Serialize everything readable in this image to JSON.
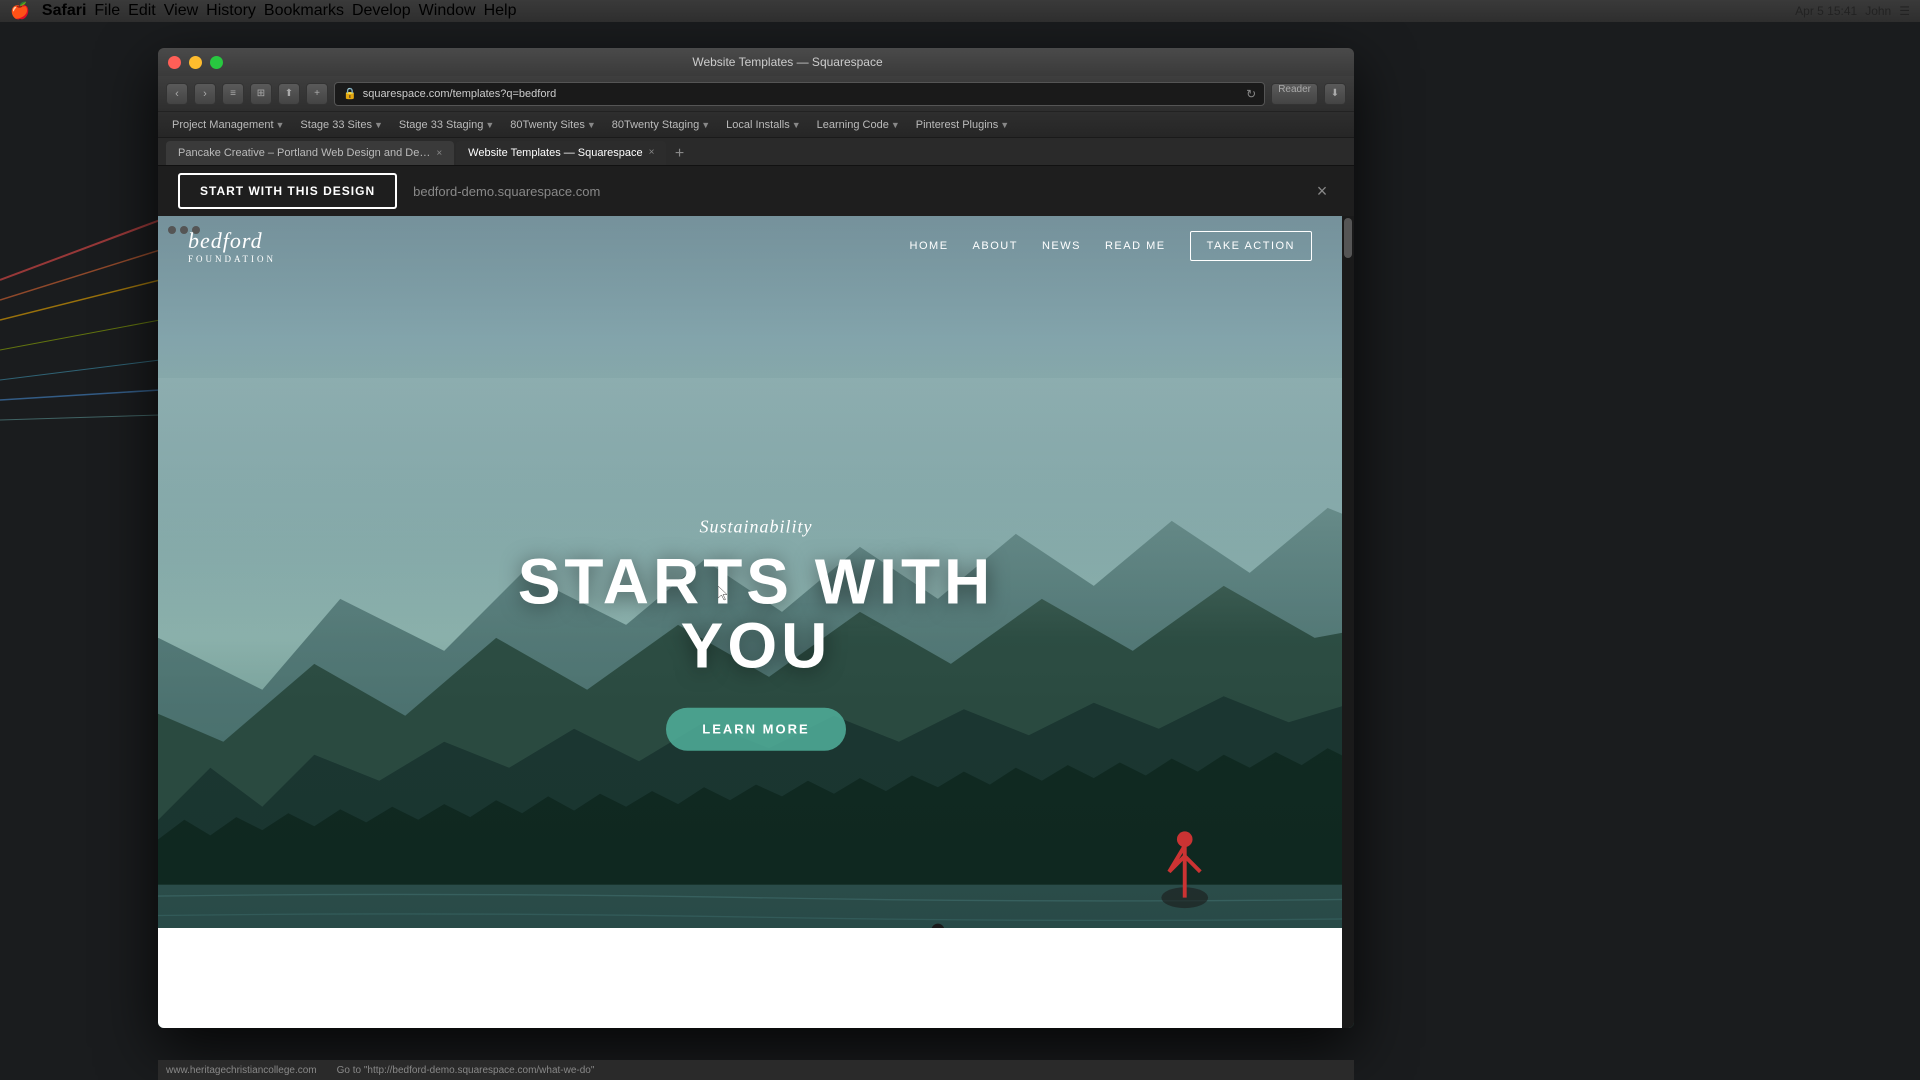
{
  "macos": {
    "menubar": {
      "apple": "🍎",
      "app": "Safari",
      "menus": [
        "File",
        "Edit",
        "View",
        "History",
        "Bookmarks",
        "Develop",
        "Window",
        "Help"
      ],
      "time": "15:41",
      "date": "Apr 5",
      "user": "John"
    }
  },
  "browser": {
    "title": "Website Templates — Squarespace",
    "url": "squarespace.com/templates?q=bedford",
    "reader_label": "Reader",
    "bookmarks": [
      {
        "label": "Project Management",
        "has_dropdown": true
      },
      {
        "label": "Stage 33 Sites",
        "has_dropdown": true
      },
      {
        "label": "Stage 33 Staging",
        "has_dropdown": true
      },
      {
        "label": "80Twenty Sites",
        "has_dropdown": true
      },
      {
        "label": "80Twenty Staging",
        "has_dropdown": true
      },
      {
        "label": "Local Installs",
        "has_dropdown": true
      },
      {
        "label": "Learning Code",
        "has_dropdown": true
      },
      {
        "label": "Pinterest Plugins",
        "has_dropdown": true
      }
    ],
    "tabs": [
      {
        "label": "Pancake Creative – Portland Web Design and De…",
        "active": false
      },
      {
        "label": "Website Templates — Squarespace",
        "active": true
      }
    ]
  },
  "squarespace": {
    "start_button": "START WITH THIS DESIGN",
    "demo_url": "bedford-demo.squarespace.com",
    "close_button": "×"
  },
  "bedford": {
    "logo_main": "bedford",
    "logo_sub": "FOUNDATION",
    "nav_links": [
      "HOME",
      "ABOUT",
      "NEWS",
      "READ ME"
    ],
    "nav_cta": "TAKE ACTION",
    "hero_subtitle": "Sustainability",
    "hero_title": "STARTS WITH YOU",
    "hero_cta": "LEARN MORE"
  },
  "status_bar": {
    "url": "Go to \"http://bedford-demo.squarespace.com/what-we-do\"",
    "site": "www.heritagechristiancollege.com"
  }
}
